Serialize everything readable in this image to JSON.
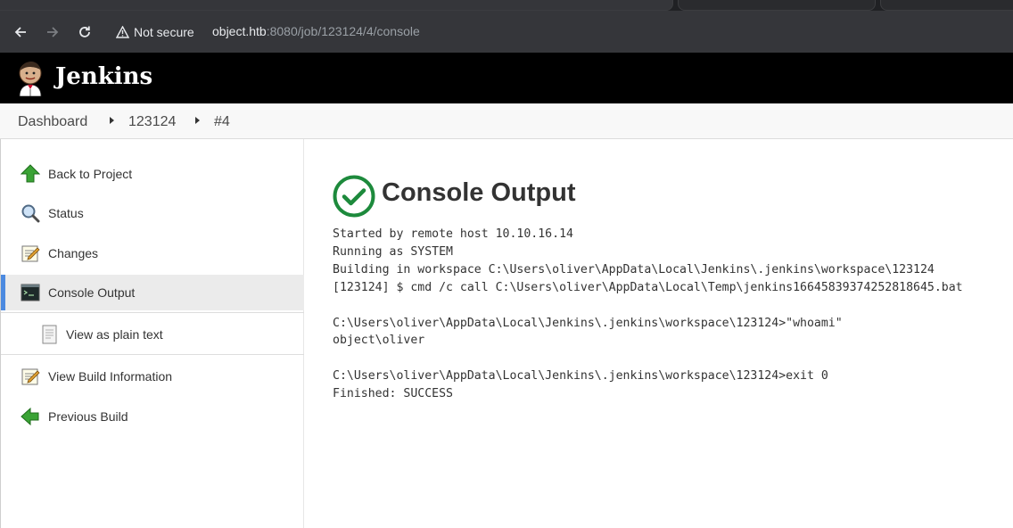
{
  "browser": {
    "security_label": "Not secure",
    "url_host": "object.htb",
    "url_rest": ":8080/job/123124/4/console"
  },
  "header": {
    "brand": "Jenkins"
  },
  "breadcrumbs": [
    "Dashboard",
    "123124",
    "#4"
  ],
  "sidepanel": {
    "back": "Back to Project",
    "status": "Status",
    "changes": "Changes",
    "console_output": "Console Output",
    "plain_text": "View as plain text",
    "build_info": "View Build Information",
    "previous": "Previous Build"
  },
  "main": {
    "title": "Console Output",
    "console_lines": [
      "Started by remote host 10.10.16.14",
      "Running as SYSTEM",
      "Building in workspace C:\\Users\\oliver\\AppData\\Local\\Jenkins\\.jenkins\\workspace\\123124",
      "[123124] $ cmd /c call C:\\Users\\oliver\\AppData\\Local\\Temp\\jenkins16645839374252818645.bat",
      "",
      "C:\\Users\\oliver\\AppData\\Local\\Jenkins\\.jenkins\\workspace\\123124>\"whoami\"",
      "object\\oliver",
      "",
      "C:\\Users\\oliver\\AppData\\Local\\Jenkins\\.jenkins\\workspace\\123124>exit 0",
      "Finished: SUCCESS"
    ]
  },
  "colors": {
    "header_bg": "#000000",
    "success": "#1d8a3c",
    "active_accent": "#4c8ae0"
  }
}
